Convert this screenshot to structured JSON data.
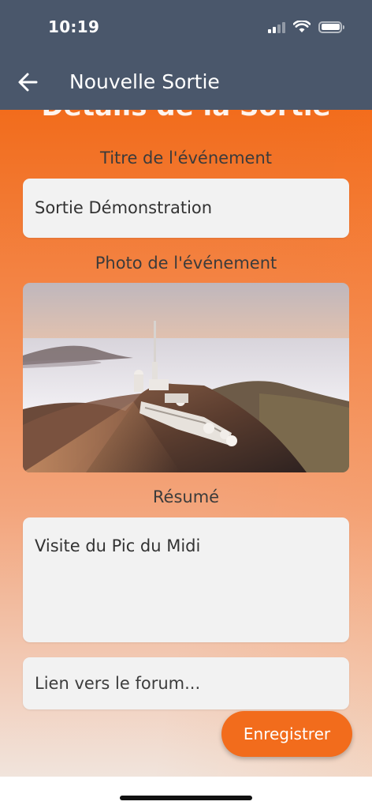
{
  "status_bar": {
    "time": "10:19"
  },
  "nav": {
    "title": "Nouvelle Sortie"
  },
  "form": {
    "section_heading": "Détails de la Sortie",
    "title_label": "Titre de l'événement",
    "title_value": "Sortie Démonstration",
    "photo_label": "Photo de l'événement",
    "summary_label": "Résumé",
    "summary_value": "Visite du Pic du Midi",
    "forum_placeholder": "Lien vers le forum..."
  },
  "actions": {
    "save_label": "Enregistrer"
  },
  "colors": {
    "header": "#4a576b",
    "accent": "#f26c1c",
    "field_bg": "#f2f2f2"
  },
  "icons": {
    "back": "arrow-left-icon",
    "signal": "cellular-signal-icon",
    "wifi": "wifi-icon",
    "battery": "battery-icon"
  }
}
